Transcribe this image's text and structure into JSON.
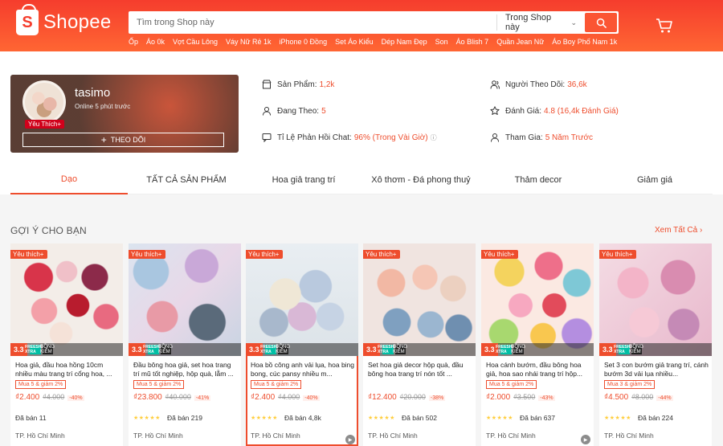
{
  "header": {
    "brand": "Shopee",
    "search_placeholder": "Tìm trong Shop này",
    "search_scope": "Trong Shop này",
    "suggestions": [
      "Ốp",
      "Áo 0k",
      "Vợt Cầu Lông",
      "Váy Nữ Rẻ 1k",
      "iPhone 0 Đồng",
      "Set Áo Kiểu",
      "Dép Nam Đẹp",
      "Son",
      "Áo Blish 7",
      "Quần Jean Nữ",
      "Áo Boy Phố Nam 1k"
    ]
  },
  "shop": {
    "name": "tasimo",
    "online": "Online 5 phút trước",
    "badge": "Yêu Thích+",
    "follow_label": "THEO DÕI",
    "stats": {
      "products_label": "Sản Phẩm:",
      "products_value": "1,2k",
      "following_label": "Đang Theo:",
      "following_value": "5",
      "chat_label": "Tỉ Lệ Phản Hồi Chat:",
      "chat_value": "96% (Trong Vài Giờ)",
      "followers_label": "Người Theo Dõi:",
      "followers_value": "36,6k",
      "rating_label": "Đánh Giá:",
      "rating_value": "4.8 (16,4k Đánh Giá)",
      "joined_label": "Tham Gia:",
      "joined_value": "5 Năm Trước"
    }
  },
  "tabs": [
    "Dạo",
    "TẤT CẢ SẢN PHẨM",
    "Hoa giả trang trí",
    "Xô thơm - Đá phong thuỷ",
    "Thảm decor",
    "Giảm giá"
  ],
  "section": {
    "title": "GỢI Ý CHO BẠN",
    "see_all": "Xem Tất Cả"
  },
  "products": [
    {
      "tag": "Yêu thích+",
      "name": "Hoa giả, đầu hoa hồng 10cm nhiều màu trang trí cổng hoa, ...",
      "deal": "Mua 5 & giảm 2%",
      "price": "₫2.400",
      "old": "₫4.000",
      "discount": "-40%",
      "stars": "",
      "sold": "Đã bán 11",
      "location": "TP. Hồ Chí Minh"
    },
    {
      "tag": "Yêu thích+",
      "name": "Đầu bông hoa giả, set hoa trang trí mũ tốt nghiệp, hộp quà, lẵm ...",
      "deal": "Mua 5 & giảm 2%",
      "price": "₫23.800",
      "old": "₫40.000",
      "discount": "-41%",
      "stars": "★★★★★",
      "sold": "Đã bán 219",
      "location": "TP. Hồ Chí Minh"
    },
    {
      "tag": "Yêu thích+",
      "name": "Hoa bồ công anh vải lụa, hoa bing bong, cúc pansy nhiều m...",
      "deal": "Mua 5 & giảm 2%",
      "price": "₫2.400",
      "old": "₫4.000",
      "discount": "-40%",
      "stars": "★★★★★",
      "sold": "Đã bán 4,8k",
      "location": "TP. Hồ Chí Minh"
    },
    {
      "tag": "Yêu thích+",
      "name": "Set hoa giả decor hộp quà, đầu bông hoa trang trí nón tốt ...",
      "deal": "",
      "price": "₫12.400",
      "old": "₫20.000",
      "discount": "-38%",
      "stars": "★★★★★",
      "sold": "Đã bán 502",
      "location": "TP. Hồ Chí Minh"
    },
    {
      "tag": "Yêu thích+",
      "name": "Hoa cánh bướm, đầu bông hoa giả, hoa sao nhái trang trí hộp...",
      "deal": "Mua 5 & giảm 2%",
      "price": "₫2.000",
      "old": "₫3.500",
      "discount": "-43%",
      "stars": "★★★★★",
      "sold": "Đã bán 637",
      "location": "TP. Hồ Chí Minh"
    },
    {
      "tag": "Yêu thích+",
      "name": "Set 3 con bướm giả trang trí, cánh bướm 3d vải lụa nhiều...",
      "deal": "Mua 3 & giảm 2%",
      "price": "₫4.500",
      "old": "₫8.000",
      "discount": "-44%",
      "stars": "★★★★★",
      "sold": "Đã bán 224",
      "location": "TP. Hồ Chí Minh"
    }
  ],
  "promo": {
    "label_33": "3.3",
    "freeship": "FREESHIP XTRA",
    "mall": "ĐỒNG KIỂM"
  }
}
